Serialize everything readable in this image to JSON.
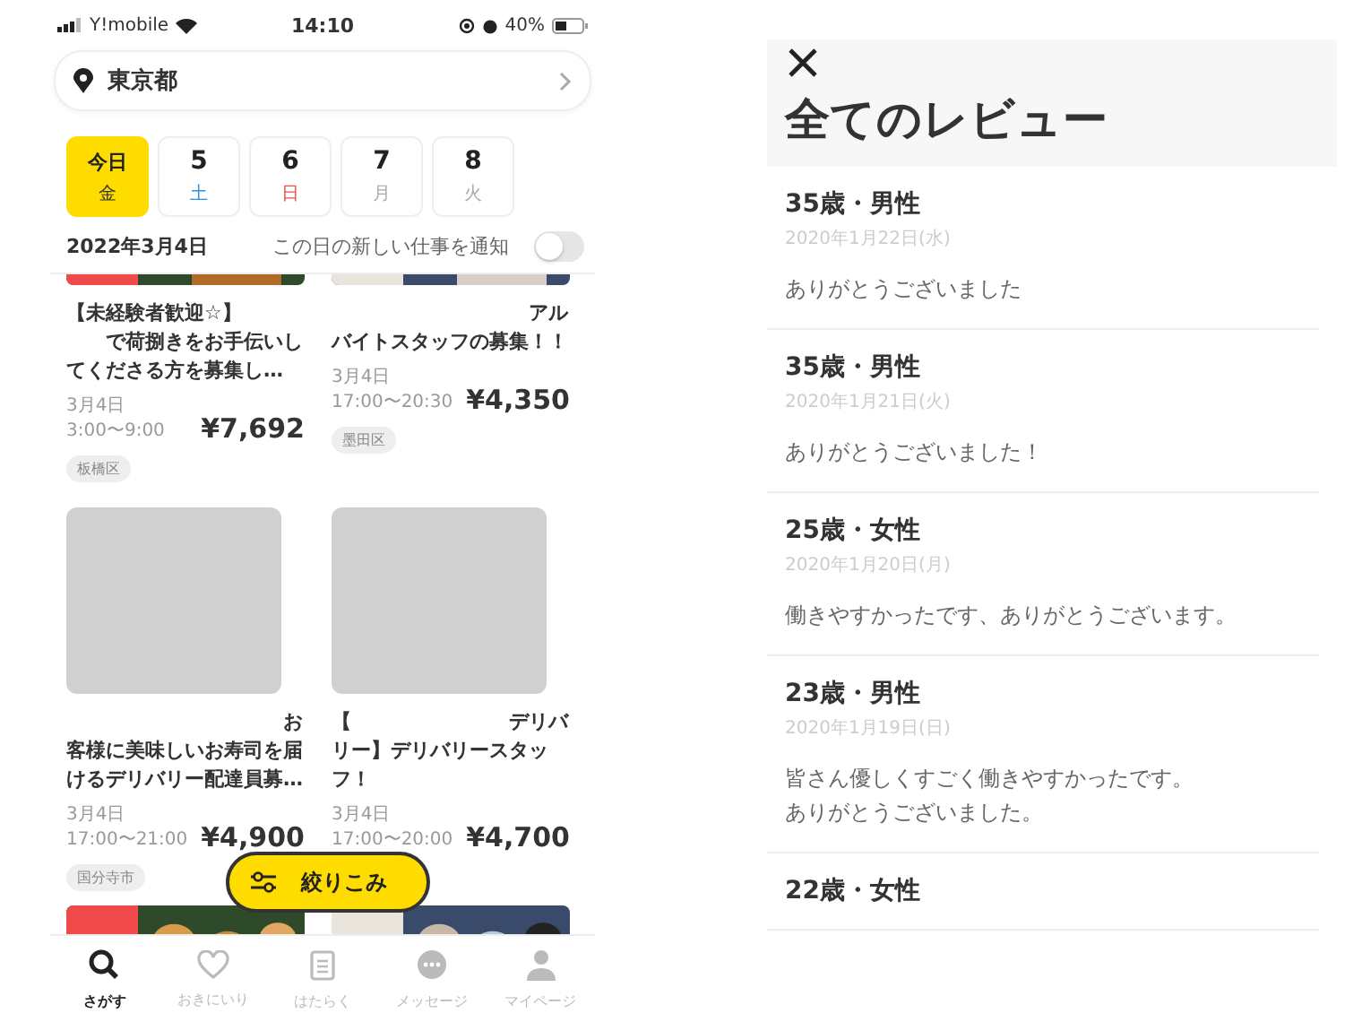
{
  "status_bar": {
    "carrier": "Y!mobile",
    "time": "14:10",
    "battery": "40%"
  },
  "location": {
    "label": "東京都"
  },
  "dates": [
    {
      "day": "今日",
      "weekday": "金",
      "color": "#333333",
      "selected": true
    },
    {
      "day": "5",
      "weekday": "土",
      "color": "#2f8fe0",
      "selected": false
    },
    {
      "day": "6",
      "weekday": "日",
      "color": "#f0504a",
      "selected": false
    },
    {
      "day": "7",
      "weekday": "月",
      "color": "#aaaaaa",
      "selected": false
    },
    {
      "day": "8",
      "weekday": "火",
      "color": "#aaaaaa",
      "selected": false
    }
  ],
  "selected_date": "2022年3月4日",
  "notify": {
    "label": "この日の新しい仕事を通知",
    "on": false
  },
  "jobs": [
    {
      "kind": "picture",
      "title_lines": [
        "【未経験者歓迎☆】",
        "　　で荷捌きをお手伝いし",
        "てくださる方を募集し…"
      ],
      "date": "3月4日",
      "time": "3:00〜9:00",
      "pay": "¥7,692",
      "area": "板橋区"
    },
    {
      "kind": "picture",
      "title_lines": [
        "　　　　　　　　　　アル",
        "バイトスタッフの募集！！"
      ],
      "date": "3月4日",
      "time": "17:00〜20:30",
      "pay": "¥4,350",
      "area": "墨田区"
    },
    {
      "kind": "blank",
      "title_lines": [
        "　　　　　　　　　　　お",
        "客様に美味しいお寿司を届",
        "けるデリバリー配達員募…"
      ],
      "date": "3月4日",
      "time": "17:00〜21:00",
      "pay": "¥4,900",
      "area": "国分寺市"
    },
    {
      "kind": "blank",
      "title_lines": [
        "【　　　　　　　　デリバ",
        "リー】デリバリースタッ",
        "フ！"
      ],
      "date": "3月4日",
      "time": "17:00〜20:00",
      "pay": "¥4,700"
    },
    {
      "kind": "picture"
    },
    {
      "kind": "picture"
    }
  ],
  "filter_button": {
    "label": "絞りこみ"
  },
  "tabs": [
    {
      "label": "さがす",
      "selected": true
    },
    {
      "label": "おきにいり",
      "selected": false
    },
    {
      "label": "はたらく",
      "selected": false
    },
    {
      "label": "メッセージ",
      "selected": false
    },
    {
      "label": "マイページ",
      "selected": false
    }
  ],
  "reviews": {
    "title": "全てのレビュー",
    "items": [
      {
        "author": "35歳・男性",
        "date": "2020年1月22日(水)",
        "comment_lines": [
          "ありがとうございました"
        ]
      },
      {
        "author": "35歳・男性",
        "date": "2020年1月21日(火)",
        "comment_lines": [
          "ありがとうございました！"
        ]
      },
      {
        "author": "25歳・女性",
        "date": "2020年1月20日(月)",
        "comment_lines": [
          "働きやすかったです、ありがとうございます。"
        ]
      },
      {
        "author": "23歳・男性",
        "date": "2020年1月19日(日)",
        "comment_lines": [
          "皆さん優しくすごく働きやすかったです。",
          "ありがとうございました。"
        ]
      },
      {
        "author": "22歳・女性"
      }
    ]
  }
}
